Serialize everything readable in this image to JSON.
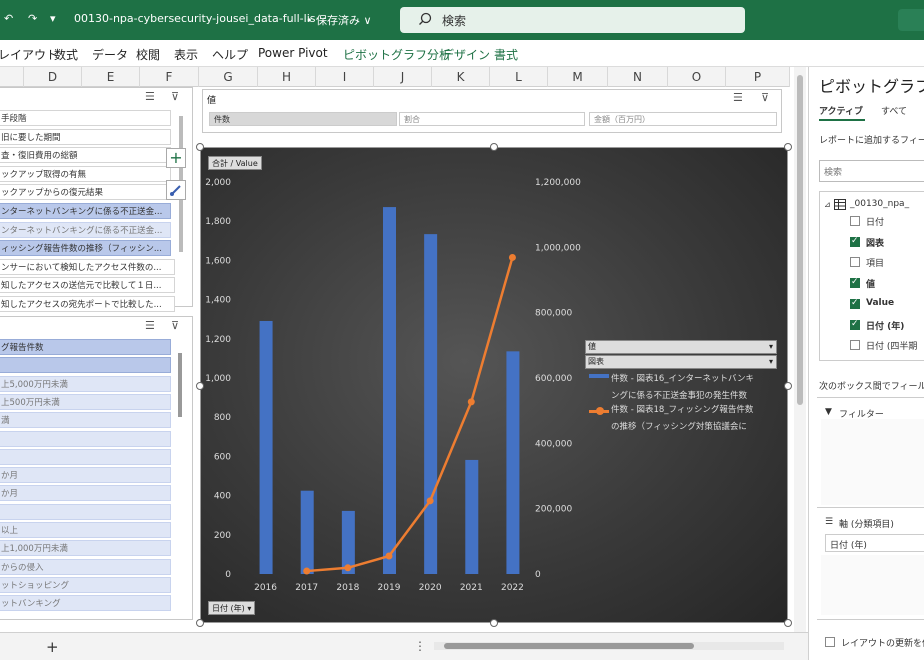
{
  "titlebar": {
    "undo": "↶",
    "redo": "↷",
    "qa_more": "▾",
    "filename": "00130-npa-cybersecurity-jousei_data-full-lis···",
    "saved": "• 保存済み ∨",
    "search": "検索"
  },
  "ribbon": {
    "tabs": [
      "レイアウト",
      "数式",
      "データ",
      "校閲",
      "表示",
      "ヘルプ",
      "Power Pivot"
    ],
    "context_tabs": [
      "ピボットグラフ分析",
      "デザイン",
      "書式"
    ]
  },
  "columns": [
    "D",
    "E",
    "F",
    "G",
    "H",
    "I",
    "J",
    "K",
    "L",
    "M",
    "N",
    "O",
    "P"
  ],
  "slicer_top": {
    "items": [
      "手段階",
      "旧に要した期間",
      "査・復旧費用の総額",
      "ックアップ取得の有無",
      "ックアップからの復元結果",
      "ンターネットバンキングに係る不正送金...",
      "ンターネットバンキングに係る不正送金...",
      "ィッシング報告件数の推移（フィッシン...",
      "ンサーにおいて検知したアクセス件数の...",
      "知したアクセスの送信元で比較して１日...",
      "知したアクセスの宛先ポートで比較した..."
    ]
  },
  "slicer_bottom": {
    "items": [
      "グ報告件数",
      "",
      "上5,000万円未満",
      "上500万円未満",
      "満",
      "",
      "",
      "か月",
      "か月",
      "",
      "以上",
      "上1,000万円未満",
      "からの侵入",
      "ットショッピング",
      "ットバンキング"
    ]
  },
  "value_slicer": {
    "title": "値",
    "buttons": [
      "件数",
      "割合",
      "金額（百万円）"
    ]
  },
  "chart_data": {
    "type": "bar",
    "value_field_button": "合計 / Value",
    "axis_field_button": "日付 (年)",
    "categories": [
      "2016",
      "2017",
      "2018",
      "2019",
      "2020",
      "2021",
      "2022"
    ],
    "series": [
      {
        "type": "bar",
        "axis": "left",
        "values": [
          1291,
          425,
          322,
          1872,
          1734,
          582,
          1136
        ],
        "color": "#4472c4"
      },
      {
        "type": "line",
        "axis": "right",
        "values": [
          null,
          9000,
          19000,
          55000,
          224000,
          527000,
          969000
        ],
        "color": "#ed7d31"
      }
    ],
    "left_axis": {
      "min": 0,
      "max": 2000,
      "ticks": [
        "0",
        "200",
        "400",
        "600",
        "800",
        "1,000",
        "1,200",
        "1,400",
        "1,600",
        "1,800",
        "2,000"
      ]
    },
    "right_axis": {
      "min": 0,
      "max": 1200000,
      "ticks": [
        "0",
        "200,000",
        "400,000",
        "600,000",
        "800,000",
        "1,000,000",
        "1,200,000"
      ]
    },
    "legend": {
      "field_button": "値",
      "field_button2": "図表",
      "entries": [
        "件数 - 図表16_インターネットバンキングに係る不正送金事犯の発生件数",
        "件数 - 図表18_フィッシング報告件数の推移（フィッシング対策協議会に"
      ],
      "entry_lines": [
        [
          "件数 - 図表16_インターネットバンキ",
          "ングに係る不正送金事犯の発生件数"
        ],
        [
          "件数 - 図表18_フィッシング報告件数",
          "の推移（フィッシング対策協議会に"
        ]
      ]
    }
  },
  "pane": {
    "title": "ピボットグラフの",
    "tab_active": "アクティブ",
    "tab_all": "すべて",
    "hint": "レポートに追加するフィール",
    "search_placeholder": "検索",
    "table": "_00130_npa_",
    "fields": [
      {
        "label": "日付",
        "checked": false
      },
      {
        "label": "図表",
        "checked": true
      },
      {
        "label": "項目",
        "checked": false
      },
      {
        "label": "値",
        "checked": true
      },
      {
        "label": "Value",
        "checked": true
      },
      {
        "label": "日付 (年)",
        "checked": true
      },
      {
        "label": "日付 (四半期",
        "checked": false
      }
    ],
    "drag_hint": "次のボックス間でフィールド",
    "filter_label": "フィルター",
    "axis_label": "軸 (分類項目)",
    "axis_value": "日付 (年)",
    "defer": "レイアウトの更新を保"
  },
  "bottom": {
    "add_sheet": "+",
    "more": "⋮"
  }
}
